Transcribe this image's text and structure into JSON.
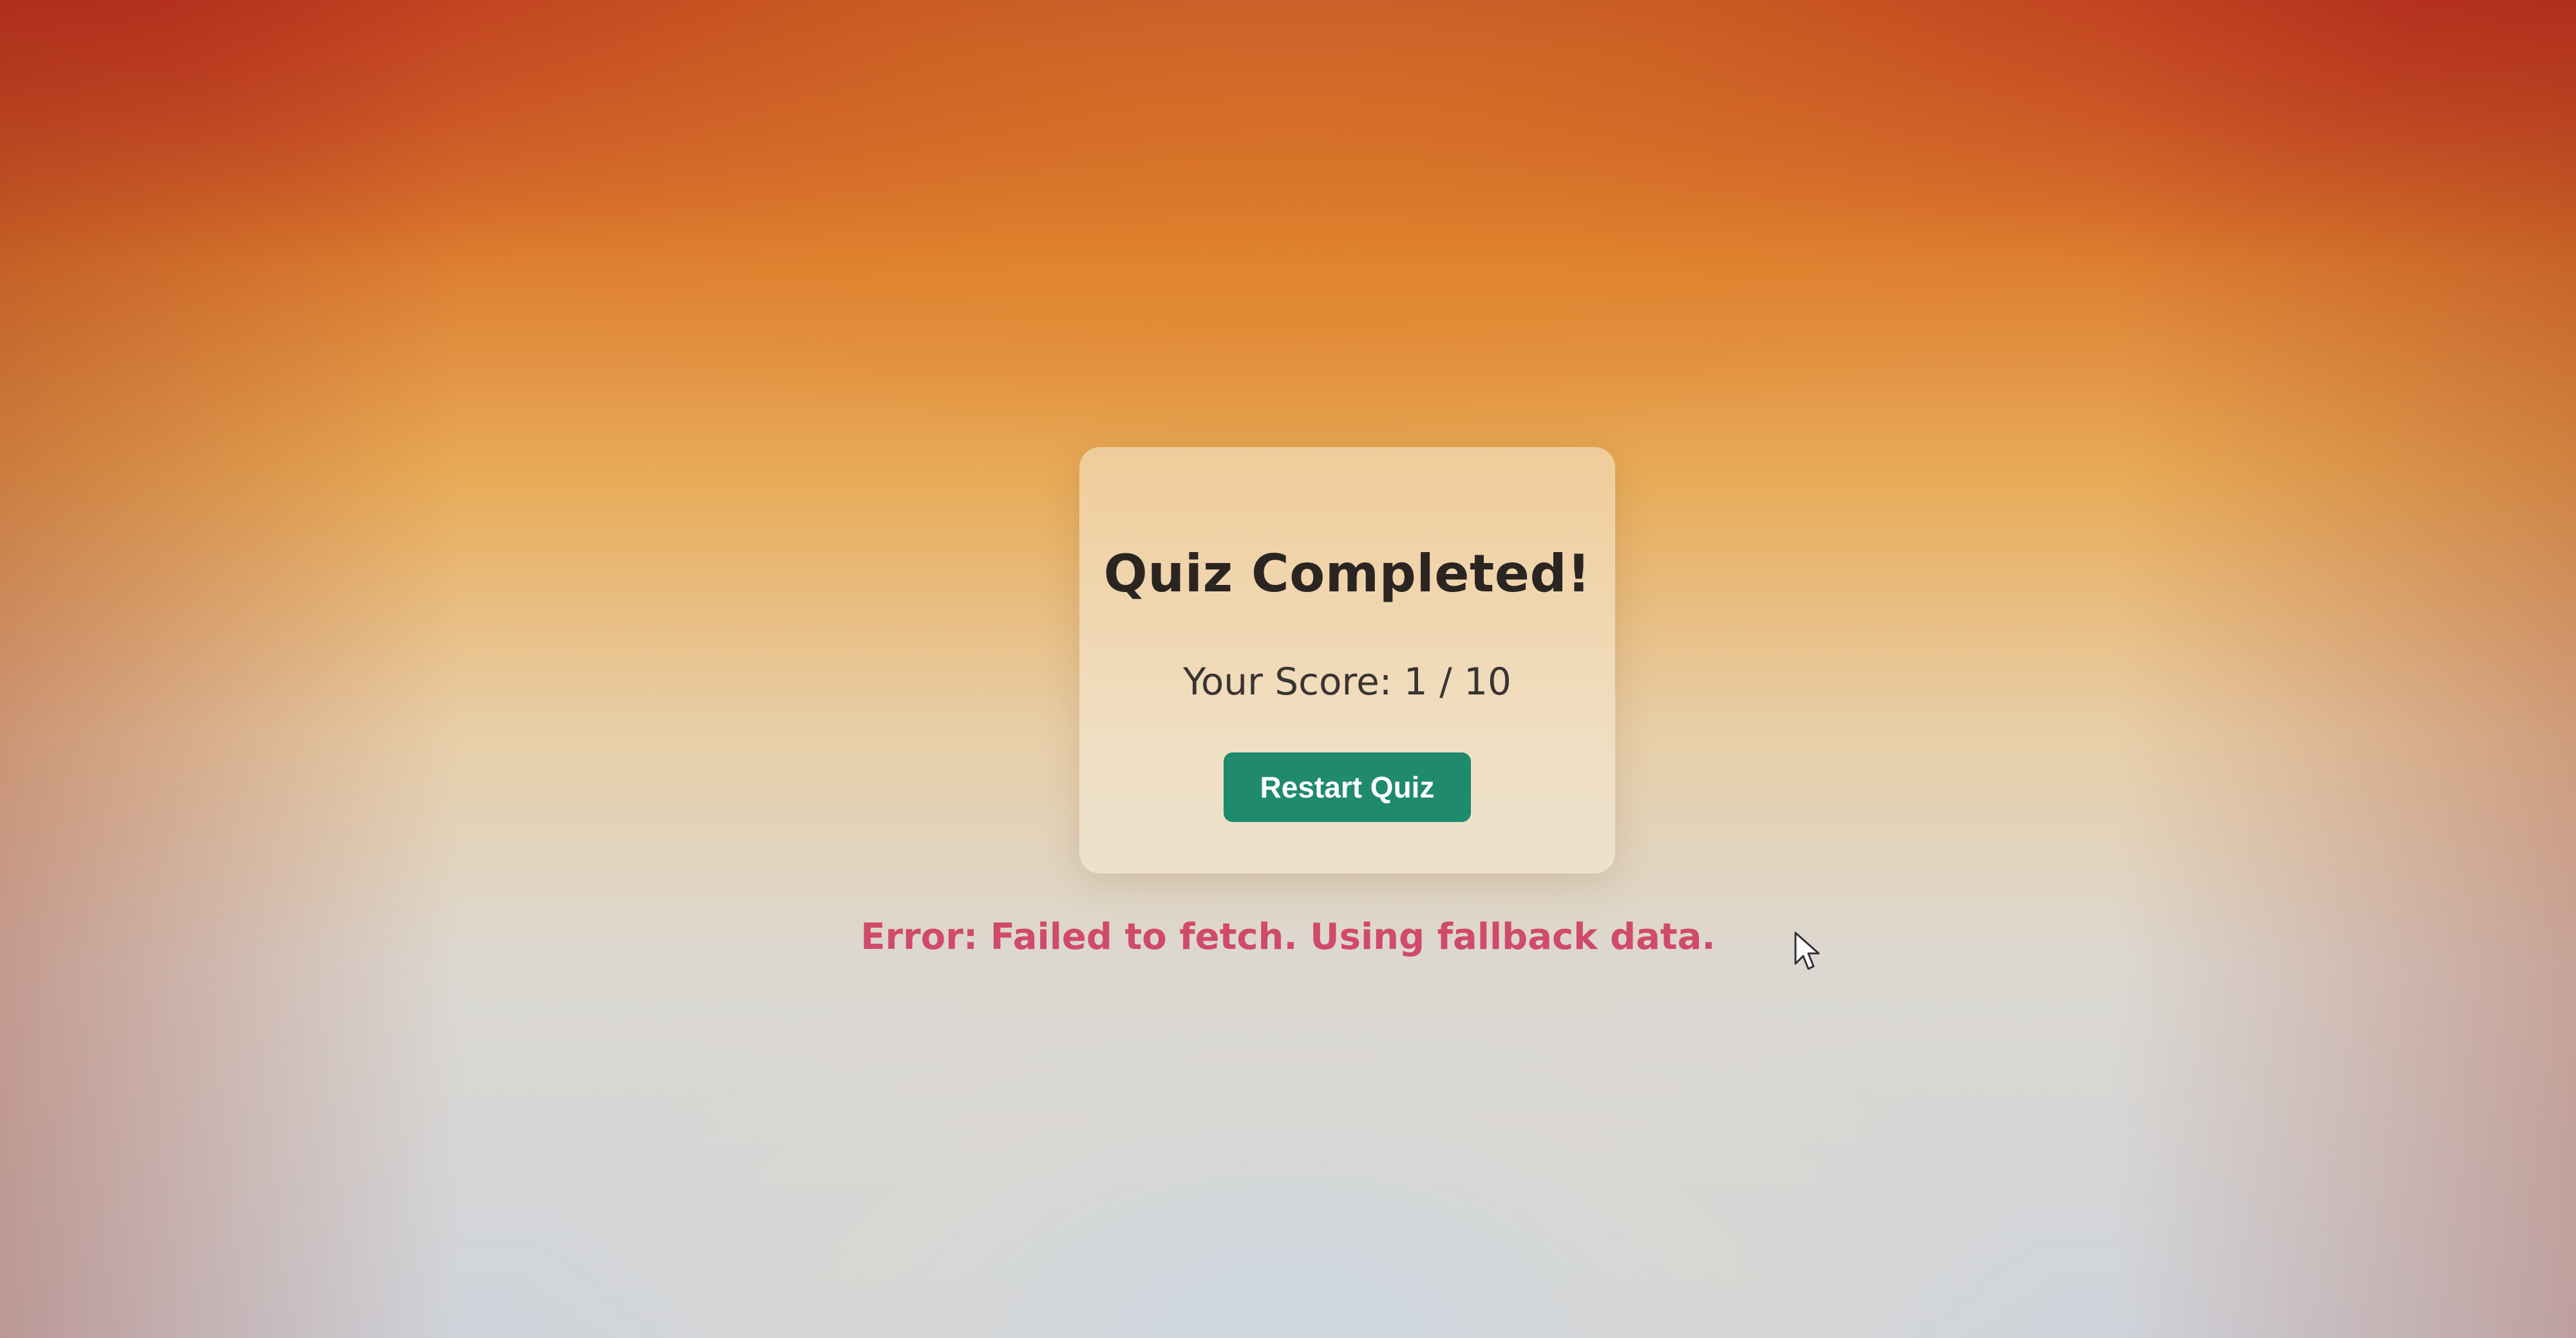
{
  "quiz": {
    "title": "Quiz Completed!",
    "score_text": "Your Score: 1 / 10",
    "score": 1,
    "total": 10,
    "restart_label": "Restart Quiz"
  },
  "error": {
    "message": "Error: Failed to fetch. Using fallback data."
  },
  "colors": {
    "button": "#1f8a6c",
    "error_text": "#d04a6a",
    "title_text": "#2b2522"
  },
  "icons": {
    "cursor": "arrow-cursor-icon"
  }
}
